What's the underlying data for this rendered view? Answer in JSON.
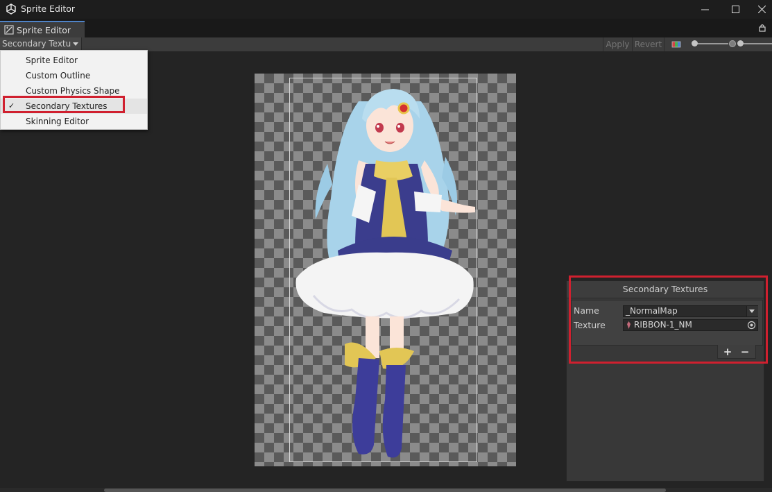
{
  "window": {
    "title": "Sprite Editor",
    "icon": "unity-icon",
    "controls": [
      "minimize-icon",
      "maximize-icon",
      "close-icon"
    ]
  },
  "tab": {
    "label": "Sprite Editor",
    "icon": "sprite-editor-icon",
    "lock_icon": "lock-icon"
  },
  "toolbar": {
    "mode_selected": "Secondary Textur",
    "apply_label": "Apply",
    "revert_label": "Revert",
    "color_channel_icon": "rgb-channel-icon",
    "mip_icon": "mip-level-icon"
  },
  "mode_menu": {
    "items": [
      {
        "label": "Sprite Editor",
        "checked": false
      },
      {
        "label": "Custom Outline",
        "checked": false
      },
      {
        "label": "Custom Physics Shape",
        "checked": false
      },
      {
        "label": "Secondary Textures",
        "checked": true
      },
      {
        "label": "Skinning Editor",
        "checked": false
      }
    ],
    "check_glyph": "✓"
  },
  "secondary_textures": {
    "title": "Secondary Textures",
    "name_label": "Name",
    "name_value": "_NormalMap",
    "texture_label": "Texture",
    "texture_value": "RIBBON-1_NM",
    "add_label": "+",
    "remove_label": "−"
  },
  "colors": {
    "highlight": "#d0202f",
    "tab_accent": "#4f83c7",
    "menu_bg": "#f2f2f2",
    "panel_bg": "#383838"
  }
}
